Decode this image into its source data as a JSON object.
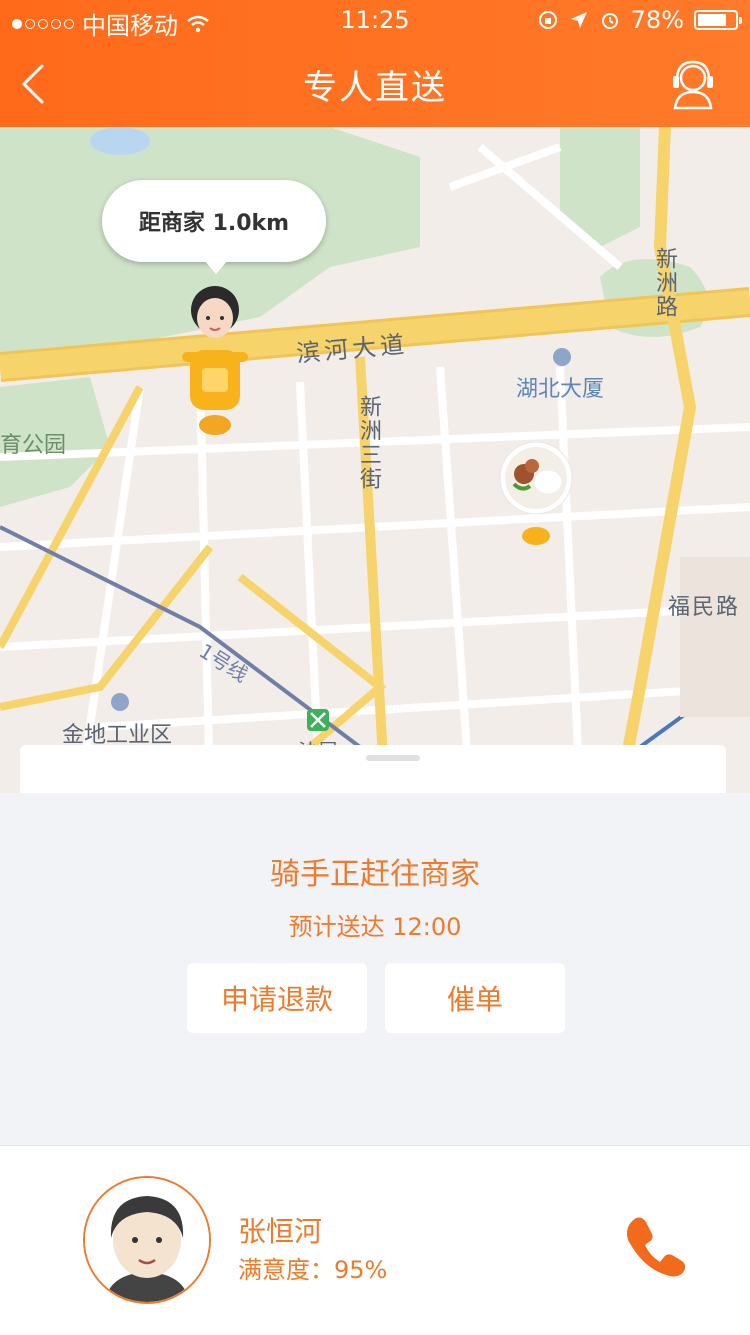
{
  "status_bar": {
    "carrier": "中国移动",
    "time": "11:25",
    "battery": "78%",
    "battery_level": 0.78,
    "signal_bars_filled": 1,
    "signal_bars_total": 5
  },
  "nav": {
    "title": "专人直送",
    "back_icon": "chevron-left-icon",
    "service_icon": "customer-service-headset-icon"
  },
  "map": {
    "distance_bubble": "距商家 1.0km",
    "labels": {
      "binhe": "滨河大道",
      "xinzhou_road": "新洲路",
      "hubei_building": "湖北大厦",
      "xinzhou_3rd": "新洲三街",
      "park": "育公园",
      "fumin": "福民路",
      "line1": "1号线",
      "jindi": "金地工业区",
      "shawei": "沙尾"
    }
  },
  "delivery": {
    "status": "骑手正赶往商家",
    "eta": "预计送达 12:00",
    "refund_button": "申请退款",
    "urge_button": "催单"
  },
  "rider": {
    "name": "张恒河",
    "satisfaction": "满意度：95%",
    "phone_icon": "phone-icon"
  },
  "colors": {
    "accent": "#ff6a1a",
    "text_accent": "#f07a2a",
    "road_yellow": "#f7d36b",
    "background": "#f2f3f7"
  }
}
